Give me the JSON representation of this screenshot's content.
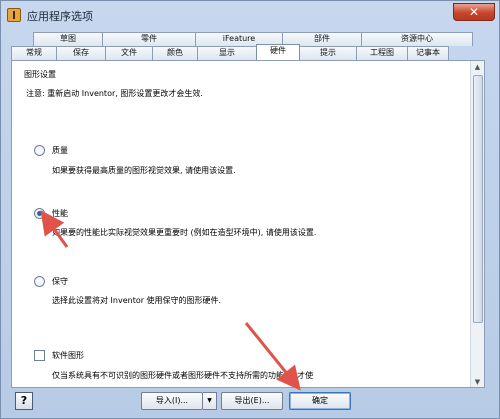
{
  "window": {
    "title": "应用程序选项",
    "close_glyph": "✕"
  },
  "tabs": {
    "back_row": [
      "草图",
      "零件",
      "iFeature",
      "部件",
      "资源中心"
    ],
    "front_row": [
      "常规",
      "保存",
      "文件",
      "颜色",
      "显示",
      "硬件",
      "提示",
      "工程图",
      "记事本"
    ],
    "active": "硬件"
  },
  "panel": {
    "group_title": "图形设置",
    "note": "注意: 重新启动 Inventor, 图形设置更改才会生效.",
    "options": [
      {
        "label": "质量",
        "desc": "如果要获得最高质量的图形视觉效果, 请使用该设置.",
        "checked": false
      },
      {
        "label": "性能",
        "desc": "如果要的性能比实际视觉效果更重要时 (例如在造型环境中), 请使用该设置.",
        "checked": true
      },
      {
        "label": "保守",
        "desc": "选择此设置将对 Inventor 使用保守的图形硬件.",
        "checked": false
      }
    ],
    "software_graphics": {
      "label": "软件图形",
      "desc": "仅当系统具有不可识别的图形硬件或者图形硬件不支持所需的功能时, 才使"
    }
  },
  "footer": {
    "help": "?",
    "import_label": "导入(I)...",
    "export_label": "导出(E)...",
    "ok_label": "确定"
  },
  "icons": {
    "app": "app-icon",
    "close": "close-icon",
    "scroll_up": "scroll-up-icon",
    "scroll_down": "scroll-down-icon",
    "dropdown": "dropdown-arrow-icon"
  },
  "colors": {
    "annotation_arrow": "#e0524a",
    "accent": "#2d64a8"
  }
}
